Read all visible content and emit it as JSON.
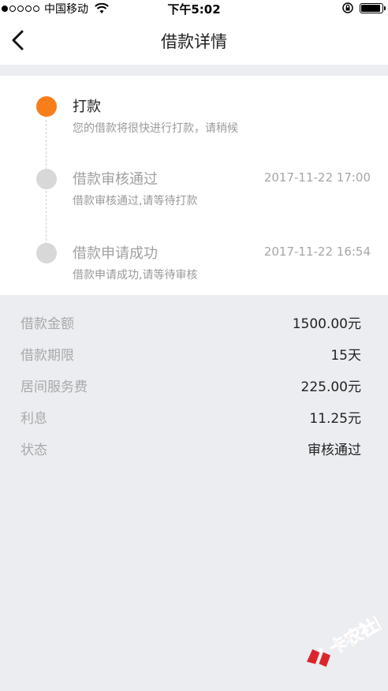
{
  "status_bar": {
    "carrier": "中国移动",
    "time": "下午5:02",
    "signal_dots": [
      true,
      false,
      false,
      false,
      false
    ]
  },
  "nav": {
    "title": "借款详情",
    "back_icon": "chevron-left-icon"
  },
  "timeline": {
    "steps": [
      {
        "title": "打款",
        "desc": "您的借款将很快进行打款，请稍候",
        "time": "",
        "active": true
      },
      {
        "title": "借款审核通过",
        "desc": "借款审核通过,请等待打款",
        "time": "2017-11-22 17:00",
        "active": false
      },
      {
        "title": "借款申请成功",
        "desc": "借款申请成功,请等待审核",
        "time": "2017-11-22 16:54",
        "active": false
      }
    ],
    "colors": {
      "active": "#f87d1b",
      "inactive": "#d8d8d8"
    }
  },
  "details": [
    {
      "label": "借款金额",
      "value": "1500.00元"
    },
    {
      "label": "借款期限",
      "value": "15天"
    },
    {
      "label": "居间服务费",
      "value": "225.00元"
    },
    {
      "label": "利息",
      "value": "11.25元"
    },
    {
      "label": "状态",
      "value": "审核通过"
    }
  ],
  "watermark": {
    "text": "卡农社区"
  }
}
